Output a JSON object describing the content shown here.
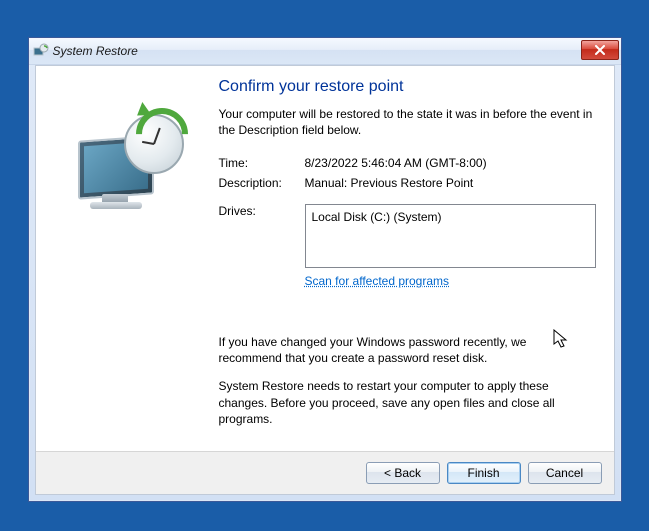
{
  "window": {
    "title": "System Restore"
  },
  "heading": "Confirm your restore point",
  "subtext": "Your computer will be restored to the state it was in before the event in the Description field below.",
  "labels": {
    "time": "Time:",
    "description": "Description:",
    "drives": "Drives:"
  },
  "values": {
    "time": "8/23/2022 5:46:04 AM (GMT-8:00)",
    "description": "Manual: Previous Restore Point"
  },
  "drives": [
    "Local Disk (C:) (System)"
  ],
  "scan_link": "Scan for affected programs",
  "footer": {
    "p1": "If you have changed your Windows password recently, we recommend that you create a password reset disk.",
    "p2": "System Restore needs to restart your computer to apply these changes. Before you proceed, save any open files and close all programs."
  },
  "buttons": {
    "back": "< Back",
    "finish": "Finish",
    "cancel": "Cancel"
  }
}
